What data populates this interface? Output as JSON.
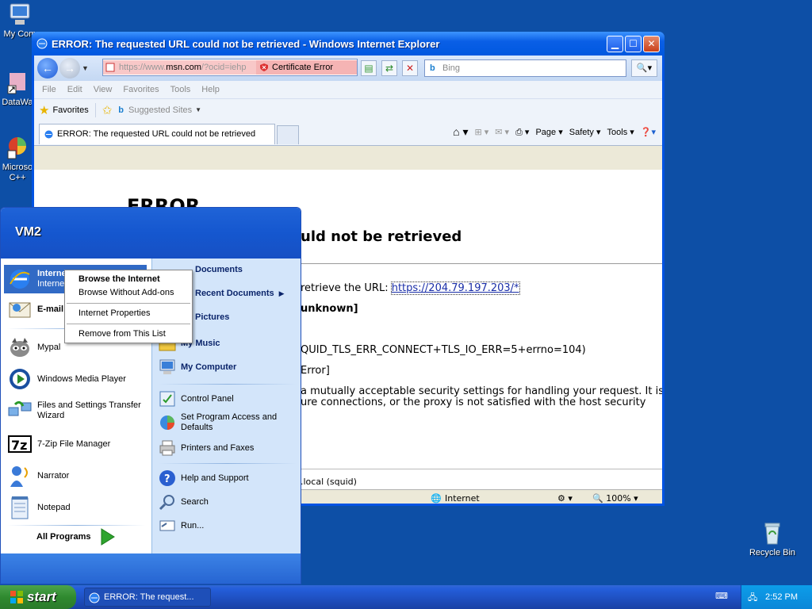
{
  "desktop": {
    "icons": [
      {
        "label": "My Com",
        "icon": "my-computer-icon"
      },
      {
        "label": "DataWa",
        "icon": "shortcut-icon"
      },
      {
        "label": "Microso C++",
        "icon": "app-shortcut-icon"
      },
      {
        "label": "Recycle Bin",
        "icon": "recycle-bin-icon"
      }
    ]
  },
  "ie": {
    "title": "ERROR: The requested URL could not be retrieved - Windows Internet Explorer",
    "address_prefix": "https://www.",
    "address_host": "msn.com",
    "address_rest": "/?ocid=iehp",
    "cert_error": "Certificate Error",
    "search_placeholder": "Bing",
    "menu": [
      "File",
      "Edit",
      "View",
      "Favorites",
      "Tools",
      "Help"
    ],
    "favorites": "Favorites",
    "suggested_sites": "Suggested Sites",
    "tab_title": "ERROR: The requested URL could not be retrieved",
    "commands": {
      "page": "Page",
      "safety": "Safety",
      "tools": "Tools"
    },
    "status_zone": "Internet",
    "zoom": "100%"
  },
  "page": {
    "heading": "ERROR",
    "subheading": "uld not be retrieved",
    "line1_text": "retrieve the URL: ",
    "line1_link": "https://204.79.197.203/*",
    "line2": "unknown]",
    "line3": "QUID_TLS_ERR_CONNECT+TLS_IO_ERR=5+errno=104)",
    "line4": "Error]",
    "line5a": "a mutually acceptable security settings for handling your request. It is",
    "line5b": "ure connections, or the proxy is not satisfied with the host security",
    "footer": ".local (squid)"
  },
  "start_menu": {
    "user": "VM2",
    "pinned": [
      {
        "title": "Internet",
        "subtitle": "Interne"
      },
      {
        "title": "E-mail",
        "subtitle": ""
      }
    ],
    "recent": [
      "Mypal",
      "Windows Media Player",
      "Files and Settings Transfer Wizard",
      "7-Zip File Manager",
      "Narrator",
      "Notepad"
    ],
    "all_programs": "All Programs",
    "right": {
      "documents": "Documents",
      "recent_documents": "Recent Documents",
      "pictures": "Pictures",
      "music": "My Music",
      "computer": "My Computer",
      "control_panel": "Control Panel",
      "program_access": "Set Program Access and Defaults",
      "printers": "Printers and Faxes",
      "help": "Help and Support",
      "search": "Search",
      "run": "Run..."
    }
  },
  "context_menu": {
    "items": [
      "Browse the Internet",
      "Browse Without Add-ons",
      "Internet Properties",
      "Remove from This List"
    ]
  },
  "taskbar": {
    "start": "start",
    "item": "ERROR: The request...",
    "clock": "2:52 PM"
  }
}
